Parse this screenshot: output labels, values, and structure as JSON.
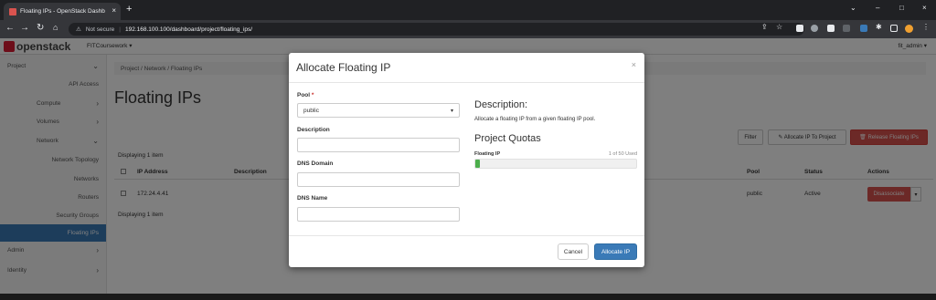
{
  "browser": {
    "tab_title": "Floating IPs - OpenStack Dashb",
    "tab_close": "×",
    "new_tab": "+",
    "security_label": "Not secure",
    "url": "192.168.100.100/dashboard/project/floating_ips/",
    "window_controls": {
      "chevron": "⌄",
      "minimize": "–",
      "maximize": "□",
      "close": "×"
    }
  },
  "topnav": {
    "logo_text": "openstack",
    "project_selector": "FITCoursework ▾",
    "user_menu": "fit_admin ▾"
  },
  "sidebar": {
    "items": [
      {
        "label": "Project",
        "chevron": "⌄"
      },
      {
        "label": "API Access"
      },
      {
        "label": "Compute",
        "chevron": "›"
      },
      {
        "label": "Volumes",
        "chevron": "›"
      },
      {
        "label": "Network",
        "chevron": "⌄"
      },
      {
        "label": "Network Topology"
      },
      {
        "label": "Networks"
      },
      {
        "label": "Routers"
      },
      {
        "label": "Security Groups"
      },
      {
        "label": "Floating IPs"
      },
      {
        "label": "Admin",
        "chevron": "›"
      },
      {
        "label": "Identity",
        "chevron": "›"
      }
    ]
  },
  "main": {
    "breadcrumb": "Project /  Network /  Floating IPs",
    "page_title": "Floating IPs",
    "toolbar": {
      "filter_label": "Filter",
      "allocate_label": "✎ Allocate IP To Project",
      "release_label": "🗑 Release Floating IPs"
    },
    "table": {
      "displaying_top": "Displaying 1 item",
      "displaying_bottom": "Displaying 1 item",
      "headers": {
        "ip_address": "IP Address",
        "description": "Description",
        "pool": "Pool",
        "status": "Status",
        "actions": "Actions"
      },
      "rows": [
        {
          "ip_address": "172.24.4.41",
          "pool": "public",
          "status": "Active",
          "action": "Disassociate",
          "more": "▾"
        }
      ]
    }
  },
  "modal": {
    "title": "Allocate Floating IP",
    "close": "×",
    "pool_label": "Pool",
    "required_mark": "*",
    "pool_value": "public",
    "pool_caret": "▾",
    "description_label": "Description",
    "description_value": "",
    "dns_domain_label": "DNS Domain",
    "dns_domain_value": "",
    "dns_name_label": "DNS Name",
    "dns_name_value": "",
    "help_heading": "Description:",
    "help_text": "Allocate a floating IP from a given floating IP pool.",
    "quotas_heading": "Project Quotas",
    "quota_label": "Floating IP",
    "quota_used": "1 of 50 Used",
    "quota_fraction": 0.02,
    "cancel_label": "Cancel",
    "submit_label": "Allocate IP"
  },
  "colors": {
    "brand_red": "#da1a32",
    "primary_blue": "#3a7ab7",
    "danger_red": "#d9534f",
    "quota_green": "#4cae4c"
  }
}
